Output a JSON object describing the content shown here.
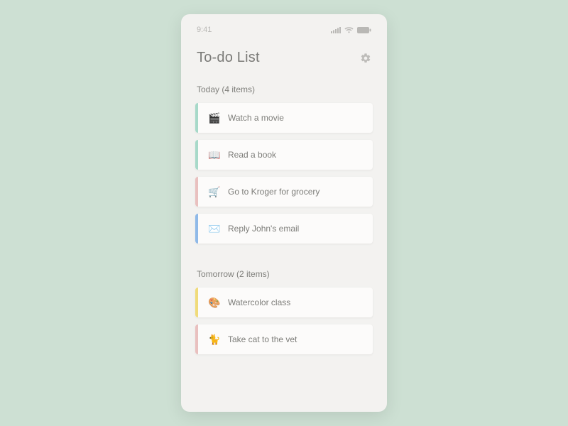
{
  "status": {
    "time": "9:41"
  },
  "header": {
    "title": "To-do List"
  },
  "sections": [
    {
      "label": "Today (4 items)",
      "items": [
        {
          "icon": "🎬",
          "text": "Watch a movie",
          "stripe": "#a7d9c9"
        },
        {
          "icon": "📖",
          "text": "Read a book",
          "stripe": "#a7d9c9"
        },
        {
          "icon": "🛒",
          "text": "Go to Kroger for grocery",
          "stripe": "#e9c0bf"
        },
        {
          "icon": "✉️",
          "text": "Reply John's email",
          "stripe": "#8fb9e8"
        }
      ]
    },
    {
      "label": "Tomorrow (2 items)",
      "items": [
        {
          "icon": "🎨",
          "text": "Watercolor class",
          "stripe": "#f0db7a"
        },
        {
          "icon": "🐈",
          "text": "Take cat to the vet",
          "stripe": "#e9c0bf"
        }
      ]
    }
  ]
}
